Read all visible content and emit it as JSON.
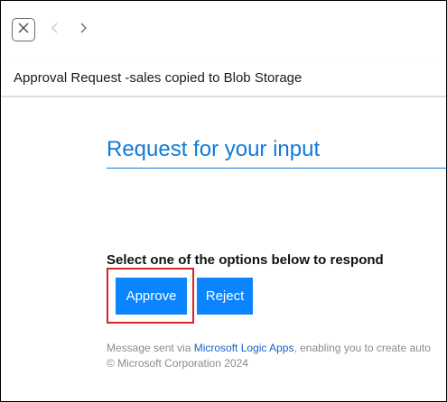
{
  "nav": {
    "close_icon": "close-icon",
    "back_icon": "chevron-left-icon",
    "forward_icon": "chevron-right-icon"
  },
  "message": {
    "subject": "Approval Request -sales copied to Blob Storage"
  },
  "card": {
    "heading": "Request for your input",
    "prompt": "Select one of the options below to respond",
    "approve_label": "Approve",
    "reject_label": "Reject"
  },
  "footer": {
    "prefix": "Message sent via ",
    "link_text": "Microsoft Logic Apps",
    "suffix": ", enabling you to create auto",
    "copyright": "© Microsoft Corporation 2024"
  },
  "colors": {
    "accent": "#0f7bd8",
    "button": "#0a84ff",
    "highlight": "#d9232a",
    "link": "#1a62c9"
  }
}
